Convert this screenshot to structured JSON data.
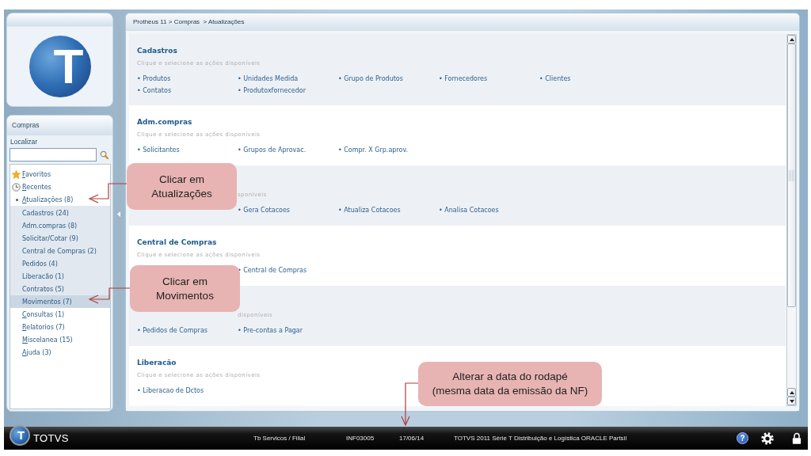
{
  "sidebar": {
    "logo_letter": "T",
    "panel_title": "Compras",
    "search": {
      "label": "Localizar"
    },
    "tree": [
      {
        "label": "Favoritos",
        "kind": "favorites",
        "mnemonic": true,
        "expanded": false,
        "selected": false
      },
      {
        "label": "Recentes",
        "kind": "recent",
        "mnemonic": true,
        "expanded": false,
        "selected": false
      },
      {
        "label": "Atualizações (8)",
        "kind": "group",
        "mnemonic": true,
        "expanded": true,
        "selected": false,
        "children": [
          {
            "label": "Cadastros (24)",
            "mnemonic": false,
            "selected": false
          },
          {
            "label": "Adm.compras (8)",
            "mnemonic": false,
            "selected": false
          },
          {
            "label": "Solicitar/Cotar (9)",
            "mnemonic": false,
            "selected": false
          },
          {
            "label": "Central de Compras (2)",
            "mnemonic": false,
            "selected": false
          },
          {
            "label": "Pedidos (4)",
            "mnemonic": false,
            "selected": false
          },
          {
            "label": "Liberacão (1)",
            "mnemonic": false,
            "selected": false
          },
          {
            "label": "Contratos (5)",
            "mnemonic": false,
            "selected": false
          },
          {
            "label": "Movimentos (7)",
            "mnemonic": false,
            "selected": true
          }
        ]
      },
      {
        "label": "Consultas (1)",
        "kind": "group",
        "mnemonic": true,
        "expanded": false,
        "selected": false
      },
      {
        "label": "Relatorios (7)",
        "kind": "group",
        "mnemonic": true,
        "expanded": false,
        "selected": false
      },
      {
        "label": "Miscelanea (15)",
        "kind": "group",
        "mnemonic": true,
        "expanded": false,
        "selected": false
      },
      {
        "label": "Ajuda (3)",
        "kind": "group",
        "mnemonic": true,
        "expanded": false,
        "selected": false
      }
    ]
  },
  "main": {
    "breadcrumb": "Protheus 11 > Compras  > Atualizações",
    "sections": [
      {
        "kind": "open",
        "title": "Cadastros",
        "subtitle": "Clique e selecione as ações disponíveis",
        "items": [
          "• Produtos",
          "• Unidades Medida",
          "• Grupo de Produtos",
          "• Fornecedores",
          "• Clientes",
          "• Contatos",
          "• Produtoxfornecedor"
        ]
      },
      {
        "kind": "open",
        "title": "Adm.compras",
        "subtitle": "Clique e selecione as ações disponíveis",
        "items": [
          "• Solicitantes",
          "• Grupos de Aprovac.",
          "• Compr. X Grp.aprov."
        ]
      },
      {
        "kind": "header_and_first_item_covered",
        "subtitle": "sponíveis",
        "items": [
          "• Gera Cotacoes",
          "• Atualiza Cotacoes",
          "• Analisa Cotacoes"
        ]
      },
      {
        "kind": "first_item_covered",
        "title": "Central de Compras",
        "subtitle": "Clique e selecione as ações disponíveis",
        "items": [
          "• Central de Compras"
        ]
      },
      {
        "kind": "header_covered",
        "subtitle": "disponíveis",
        "items": [
          "• Pedidos de Compras",
          "• Pre-contas a Pagar"
        ]
      },
      {
        "kind": "open",
        "title": "Liberacão",
        "subtitle": "Clique e selecione as ações disponíveis",
        "items": [
          "• Liberacao de Dctos"
        ]
      }
    ]
  },
  "callouts": [
    {
      "text": "Clicar em\nAtualizações"
    },
    {
      "text": "Clicar em\nMovimentos"
    },
    {
      "text": "Alterar a data do rodapé\n(mesma data da emissão da NF)"
    }
  ],
  "status_bar": {
    "logo_letter": "T",
    "brand": "TOTVS",
    "fields": [
      "Tb Servicos / Filial",
      "INF03005",
      "17/06/14",
      "TOTVS 2011 Série T Distribuição e Logística ORACLE Partsil"
    ],
    "help_label": "?"
  }
}
